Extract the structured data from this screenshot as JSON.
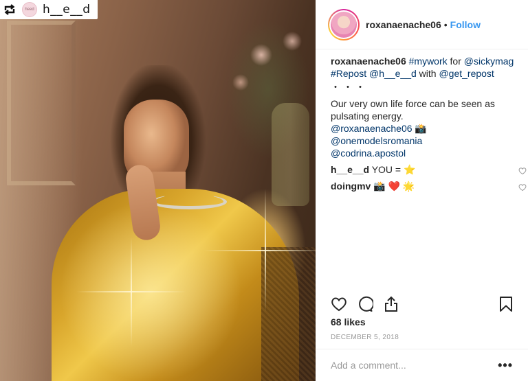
{
  "repost_badge": {
    "name": "h__e__d",
    "avatar_text": "heed"
  },
  "header": {
    "username": "roxanaenache06",
    "separator": "•",
    "follow_label": "Follow"
  },
  "caption": {
    "username": "roxanaenache06",
    "parts": [
      "#mywork",
      " for ",
      "@sickymag",
      "#Repost",
      " ",
      "@h__e__d",
      " with ",
      "@get_repost"
    ],
    "dots": "・・・",
    "body": "Our very own life force can be seen as pulsating energy.",
    "credits": [
      "@roxanaenache06",
      "📸",
      "@onemodelsromania",
      "@codrina.apostol"
    ]
  },
  "comments": [
    {
      "username": "h__e__d",
      "text": "YOU = ⭐️"
    },
    {
      "username": "doingmv",
      "text": "📸 ❤️ 🌟"
    }
  ],
  "likes": "68 likes",
  "date": "DECEMBER 5, 2018",
  "add_comment": {
    "placeholder": "Add a comment..."
  },
  "more_label": "•••",
  "colors": {
    "link": "#003569",
    "follow": "#3897f0",
    "muted": "#999999"
  }
}
